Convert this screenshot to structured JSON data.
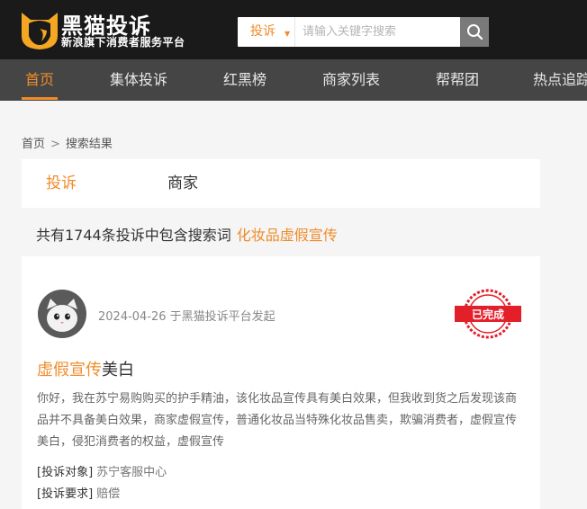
{
  "header": {
    "brand_name": "黑猫投诉",
    "brand_slogan": "新浪旗下消费者服务平台",
    "logo_icon": "black-cat-logo-icon",
    "search": {
      "scope_label": "投诉",
      "placeholder": "请输入关键字搜索",
      "value": "",
      "button_icon": "search-icon"
    }
  },
  "nav": {
    "items": [
      {
        "label": "首页",
        "active": true
      },
      {
        "label": "集体投诉",
        "active": false
      },
      {
        "label": "红黑榜",
        "active": false
      },
      {
        "label": "商家列表",
        "active": false
      },
      {
        "label": "帮帮团",
        "active": false
      },
      {
        "label": "热点追踪",
        "active": false
      }
    ]
  },
  "breadcrumb": {
    "home": "首页",
    "separator": ">",
    "current": "搜索结果"
  },
  "tabs": [
    {
      "label": "投诉",
      "active": true
    },
    {
      "label": "商家",
      "active": false
    }
  ],
  "summary": {
    "text": "共有1744条投诉中包含搜索词",
    "keyword": "化妆品虚假宣传"
  },
  "result": {
    "avatar_icon": "cat-avatar-icon",
    "meta": "2024-04-26 于黑猫投诉平台发起",
    "status_stamp": "已完成",
    "title_highlight": "虚假宣传",
    "title_rest": "美白",
    "body": "你好，我在苏宁易购购买的护手精油，该化妆品宣传具有美白效果，但我收到货之后发现该商品并不具备美白效果，商家虚假宣传，普通化妆品当特殊化妆品售卖，欺骗消费者，虚假宣传美白，侵犯消费者的权益，虚假宣传",
    "target_label": "[投诉对象]",
    "target_value": "苏宁客服中心",
    "demand_label": "[投诉要求]",
    "demand_value": "赔偿"
  },
  "colors": {
    "accent": "#f08c2c",
    "header_bg": "#1a1a1a",
    "nav_bg": "#454545",
    "stamp_red": "#e3202a"
  }
}
